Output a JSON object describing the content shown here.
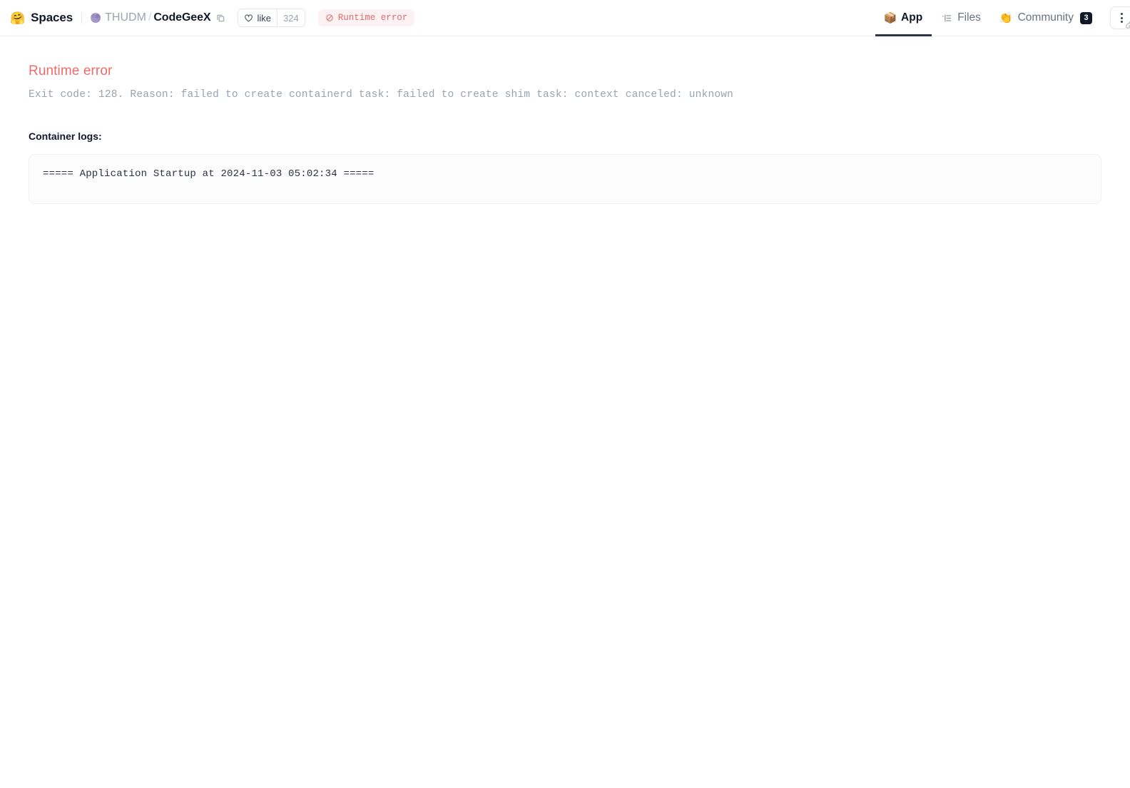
{
  "header": {
    "brand": {
      "emoji": "🤗",
      "label": "Spaces",
      "icon_name": "hugging-face-emoji"
    },
    "repo": {
      "org": "THUDM",
      "separator": "/",
      "name": "CodeGeeX",
      "copy_icon": "copy-icon",
      "avatar_icon": "org-avatar"
    },
    "like": {
      "label": "like",
      "count": "324",
      "icon": "heart-icon"
    },
    "status": {
      "label": "Runtime error",
      "icon": "no-entry-icon",
      "bg_color": "#fdf2f3",
      "text_color": "#e06a6a"
    },
    "tabs": [
      {
        "label": "App",
        "icon": "box-3d-icon",
        "glyph": "📦",
        "active": true,
        "badge": ""
      },
      {
        "label": "Files",
        "icon": "file-list-icon",
        "glyph": "",
        "active": false,
        "badge": ""
      },
      {
        "label": "Community",
        "icon": "clapping-hands-emoji",
        "glyph": "👏",
        "active": false,
        "badge": "3"
      }
    ],
    "menu_button": {
      "icon": "kebab-menu-icon",
      "secondary_icon": "link-chain-icon"
    }
  },
  "main": {
    "error_title": "Runtime error",
    "error_detail": "Exit code: 128. Reason: failed to create containerd task: failed to create shim task: context canceled: unknown",
    "logs_label": "Container logs:",
    "log_lines": [
      "===== Application Startup at 2024-11-03 05:02:34 ====="
    ]
  },
  "colors": {
    "error_red": "#ef6a6a",
    "accent_dark": "#2f3542",
    "muted_gray": "#9aa3ae"
  }
}
